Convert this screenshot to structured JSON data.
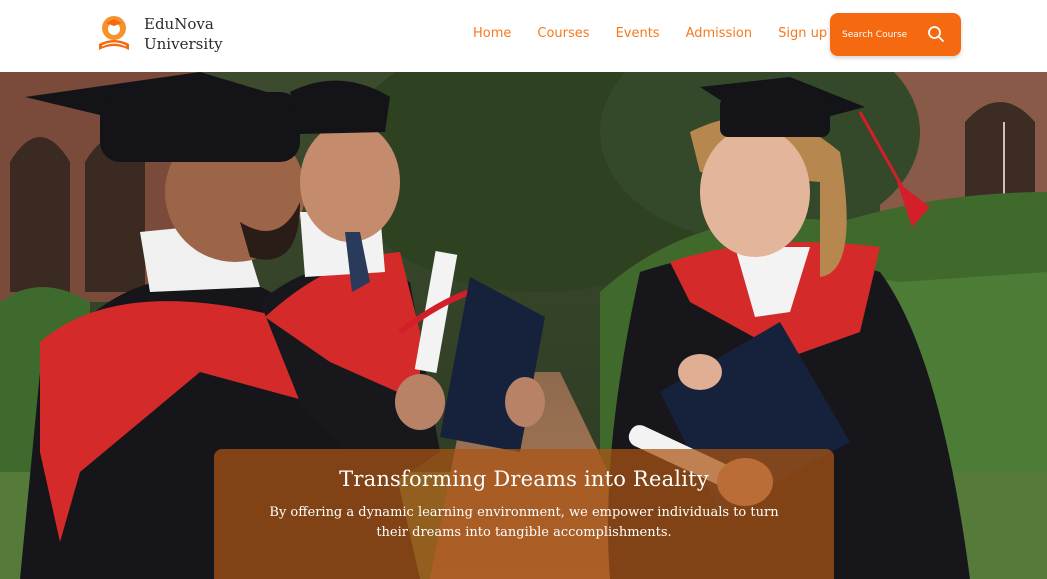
{
  "brand": {
    "line1": "EduNova",
    "line2": "University"
  },
  "nav": {
    "items": [
      "Home",
      "Courses",
      "Events",
      "Admission",
      "Sign up"
    ]
  },
  "search": {
    "label": "Search Course",
    "icon": "search-icon"
  },
  "hero": {
    "title": "Transforming Dreams into Reality",
    "text": "By offering a dynamic learning environment, we empower individuals to turn their dreams into tangible accomplishments."
  },
  "colors": {
    "accent": "#f56a10",
    "nav_text": "#f47a20",
    "overlay": "#aa5514"
  }
}
